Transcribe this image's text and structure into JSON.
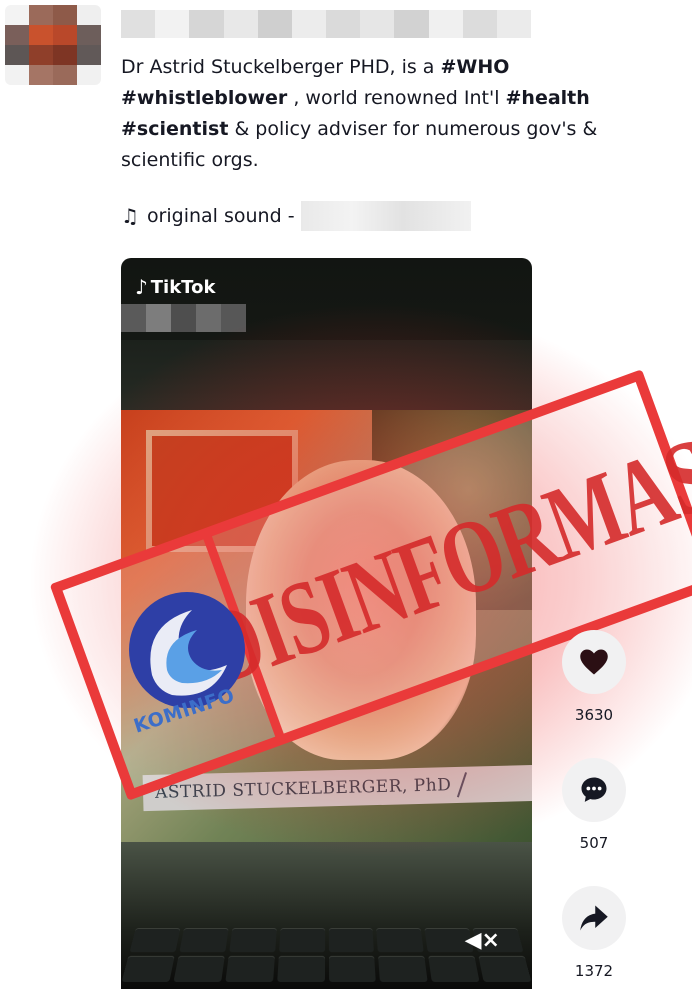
{
  "post": {
    "caption": {
      "p1": "Dr Astrid Stuckelberger PHD, is a ",
      "t1": "#WHO",
      "p2": " ",
      "t2": "#whistleblower",
      "p3": " , world renowned Int'l ",
      "t3": "#health",
      "p4": " ",
      "t4": "#scientist",
      "p5": " & policy adviser for numerous gov's & scientific orgs."
    },
    "sound": {
      "icon": "music-note-icon",
      "label": "original sound -"
    }
  },
  "video": {
    "brand": "TikTok",
    "nameplate_name": "ASTRID STUCKELBERGER, PhD"
  },
  "stamp": {
    "label": "DISINFORMASI",
    "logo_text": "KOMINFO",
    "color": "#ea3a3a"
  },
  "actions": {
    "like": {
      "icon": "heart-icon",
      "count": "3630"
    },
    "comment": {
      "icon": "comment-icon",
      "count": "507"
    },
    "share": {
      "icon": "share-icon",
      "count": "1372"
    }
  }
}
